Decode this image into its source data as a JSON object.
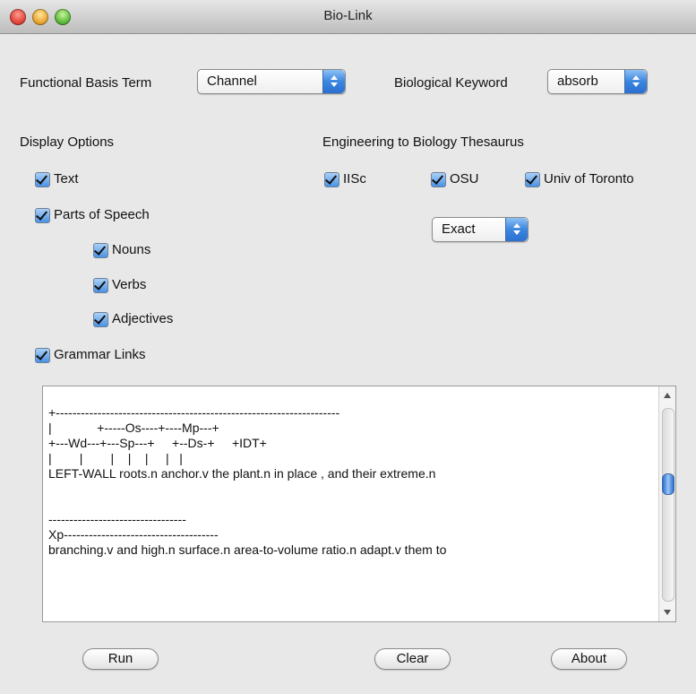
{
  "window": {
    "title": "Bio-Link"
  },
  "functional_basis": {
    "label": "Functional Basis Term",
    "selected": "Channel"
  },
  "biological_keyword": {
    "label": "Biological Keyword",
    "selected": "absorb"
  },
  "display_options": {
    "heading": "Display Options",
    "text": {
      "label": "Text",
      "checked": true
    },
    "parts_of_speech": {
      "label": "Parts of Speech",
      "checked": true
    },
    "nouns": {
      "label": "Nouns",
      "checked": true
    },
    "verbs": {
      "label": "Verbs",
      "checked": true
    },
    "adjectives": {
      "label": "Adjectives",
      "checked": true
    },
    "grammar_links": {
      "label": "Grammar Links",
      "checked": true
    }
  },
  "thesaurus": {
    "heading": "Engineering to Biology Thesaurus",
    "iisc": {
      "label": "IISc",
      "checked": true
    },
    "osu": {
      "label": "OSU",
      "checked": true
    },
    "toronto": {
      "label": "Univ of Toronto",
      "checked": true
    },
    "match_mode": "Exact"
  },
  "output": {
    "lines": [
      "+--------------------------------------------------------------------",
      "|             +-----Os----+----Mp---+",
      "+---Wd---+---Sp---+     +--Ds-+     +IDT+",
      "|        |        |    |    |     |   |",
      "LEFT-WALL roots.n anchor.v the plant.n in place , and their extreme.n",
      "",
      "",
      "---------------------------------",
      "Xp-------------------------------------",
      "branching.v and high.n surface.n area-to-volume ratio.n adapt.v them to"
    ],
    "scroll_position": 0.38
  },
  "buttons": {
    "run": "Run",
    "clear": "Clear",
    "about": "About"
  }
}
